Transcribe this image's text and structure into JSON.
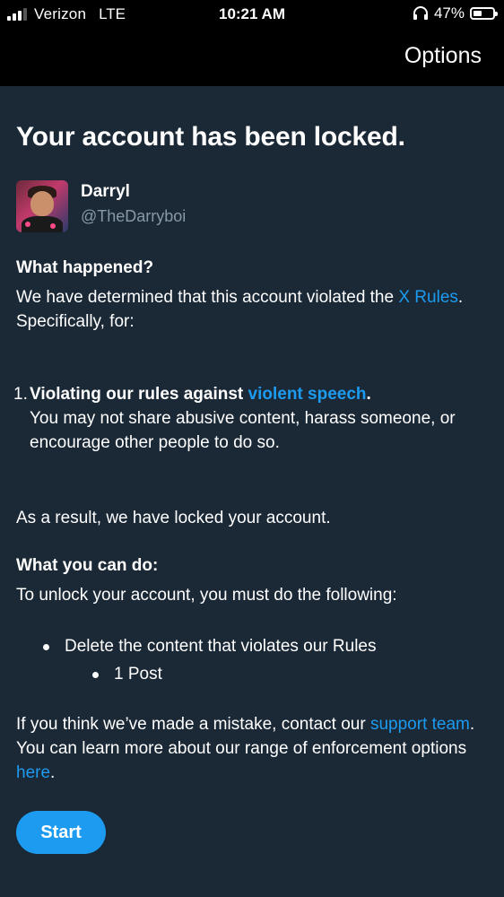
{
  "status_bar": {
    "carrier": "Verizon",
    "network": "LTE",
    "time": "10:21 AM",
    "battery_percent": "47%",
    "battery_level": 0.47,
    "icons": [
      "signal-icon",
      "headphones-icon",
      "battery-icon"
    ]
  },
  "header": {
    "options_label": "Options"
  },
  "page": {
    "title": "Your account has been locked."
  },
  "profile": {
    "display_name": "Darryl",
    "handle": "@TheDarryboi"
  },
  "what_happened": {
    "heading": "What happened?",
    "text_before": "We have determined that this account violated the ",
    "rules_link": "X Rules",
    "text_after": ". Specifically, for:"
  },
  "violations": [
    {
      "number": "1.",
      "title_before": "Violating our rules against ",
      "title_link": "violent speech",
      "title_after": ".",
      "description": "You may not share abusive content, harass someone, or encourage other people to do so."
    }
  ],
  "result_text": "As a result, we have locked your account.",
  "what_you_can_do": {
    "heading": "What you can do:",
    "intro": "To unlock your account, you must do the following:",
    "steps": [
      {
        "label": "Delete the content that violates our Rules",
        "sub": "1 Post"
      }
    ]
  },
  "mistake": {
    "text_before": "If you think we’ve made a mistake, contact our ",
    "support_link": "support team",
    "text_middle": ". You can learn more about our range of enforcement options ",
    "here_link": "here",
    "text_after": "."
  },
  "actions": {
    "start_label": "Start"
  },
  "colors": {
    "background": "#1b2836",
    "topbar": "#000000",
    "link": "#1d9bf0",
    "button": "#1d9bf0",
    "secondary_text": "#8899a6"
  }
}
